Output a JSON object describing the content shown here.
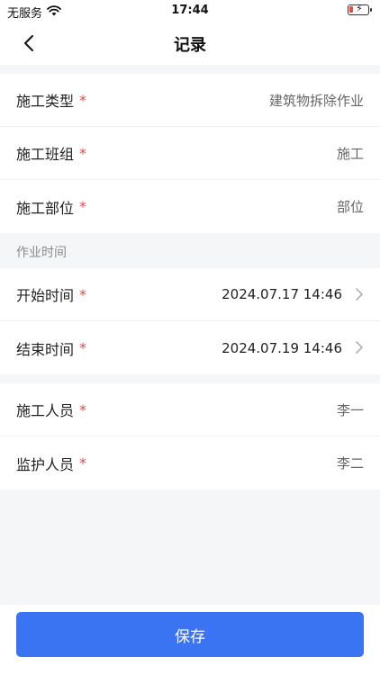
{
  "status_bar": {
    "carrier": "无服务",
    "time": "17:44"
  },
  "nav": {
    "title": "记录"
  },
  "form": {
    "required_mark": "*",
    "group1": [
      {
        "label": "施工类型",
        "value": "建筑物拆除作业"
      },
      {
        "label": "施工班组",
        "value": "施工"
      },
      {
        "label": "施工部位",
        "value": "部位"
      }
    ],
    "time_section_label": "作业时间",
    "group2": [
      {
        "label": "开始时间",
        "value": "2024.07.17 14:46"
      },
      {
        "label": "结束时间",
        "value": "2024.07.19 14:46"
      }
    ],
    "group3": [
      {
        "label": "施工人员",
        "value": "李一"
      },
      {
        "label": "监护人员",
        "value": "李二"
      }
    ]
  },
  "actions": {
    "save_label": "保存"
  },
  "colors": {
    "primary": "#3b74f2",
    "required": "#e5484d"
  }
}
